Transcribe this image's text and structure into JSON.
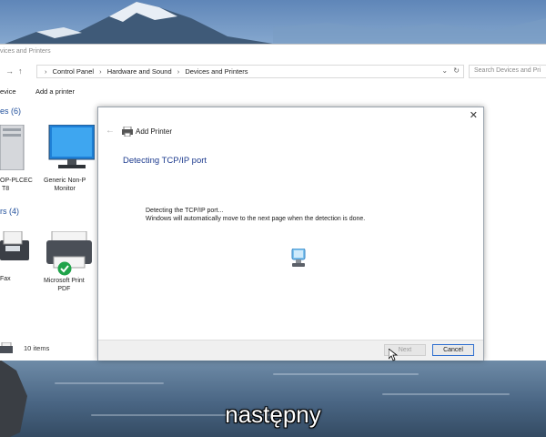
{
  "explorer": {
    "title": "vices and Printers",
    "address": {
      "crumbs": [
        "Control Panel",
        "Hardware and Sound",
        "Devices and Printers"
      ],
      "search_placeholder": "Search Devices and Pri"
    },
    "toolbar": {
      "add_device": "evice",
      "add_printer": "Add a printer"
    },
    "groups": {
      "devices": {
        "heading": "es (6)",
        "items": [
          {
            "label_line1": "OP-PLCEC",
            "label_line2": "T8"
          },
          {
            "label_line1": "Generic Non-P",
            "label_line2": "Monitor"
          }
        ]
      },
      "printers": {
        "heading": "rs (4)",
        "items": [
          {
            "label_line1": "Fax",
            "label_line2": ""
          },
          {
            "label_line1": "Microsoft Print",
            "label_line2": "PDF"
          }
        ]
      }
    },
    "status": {
      "item_count": "10 items"
    }
  },
  "dialog": {
    "title": "Add Printer",
    "heading": "Detecting TCP/IP port",
    "line1": "Detecting the TCP/IP port...",
    "line2": "Windows will automatically move to the next page when the detection is done.",
    "close_glyph": "✕",
    "back_glyph": "←",
    "buttons": {
      "next": "Next",
      "cancel": "Cancel"
    }
  },
  "subtitle": "następny",
  "colors": {
    "accent": "#1e3c8f",
    "group_heading": "#1f4e9b",
    "button_focus": "#2f6fd0"
  },
  "icons": [
    "back-arrow-icon",
    "forward-arrow-icon",
    "up-arrow-icon",
    "refresh-icon",
    "close-icon",
    "printer-icon",
    "spinner-icon",
    "monitor-icon",
    "fax-icon",
    "default-check-icon",
    "mouse-cursor-icon"
  ]
}
